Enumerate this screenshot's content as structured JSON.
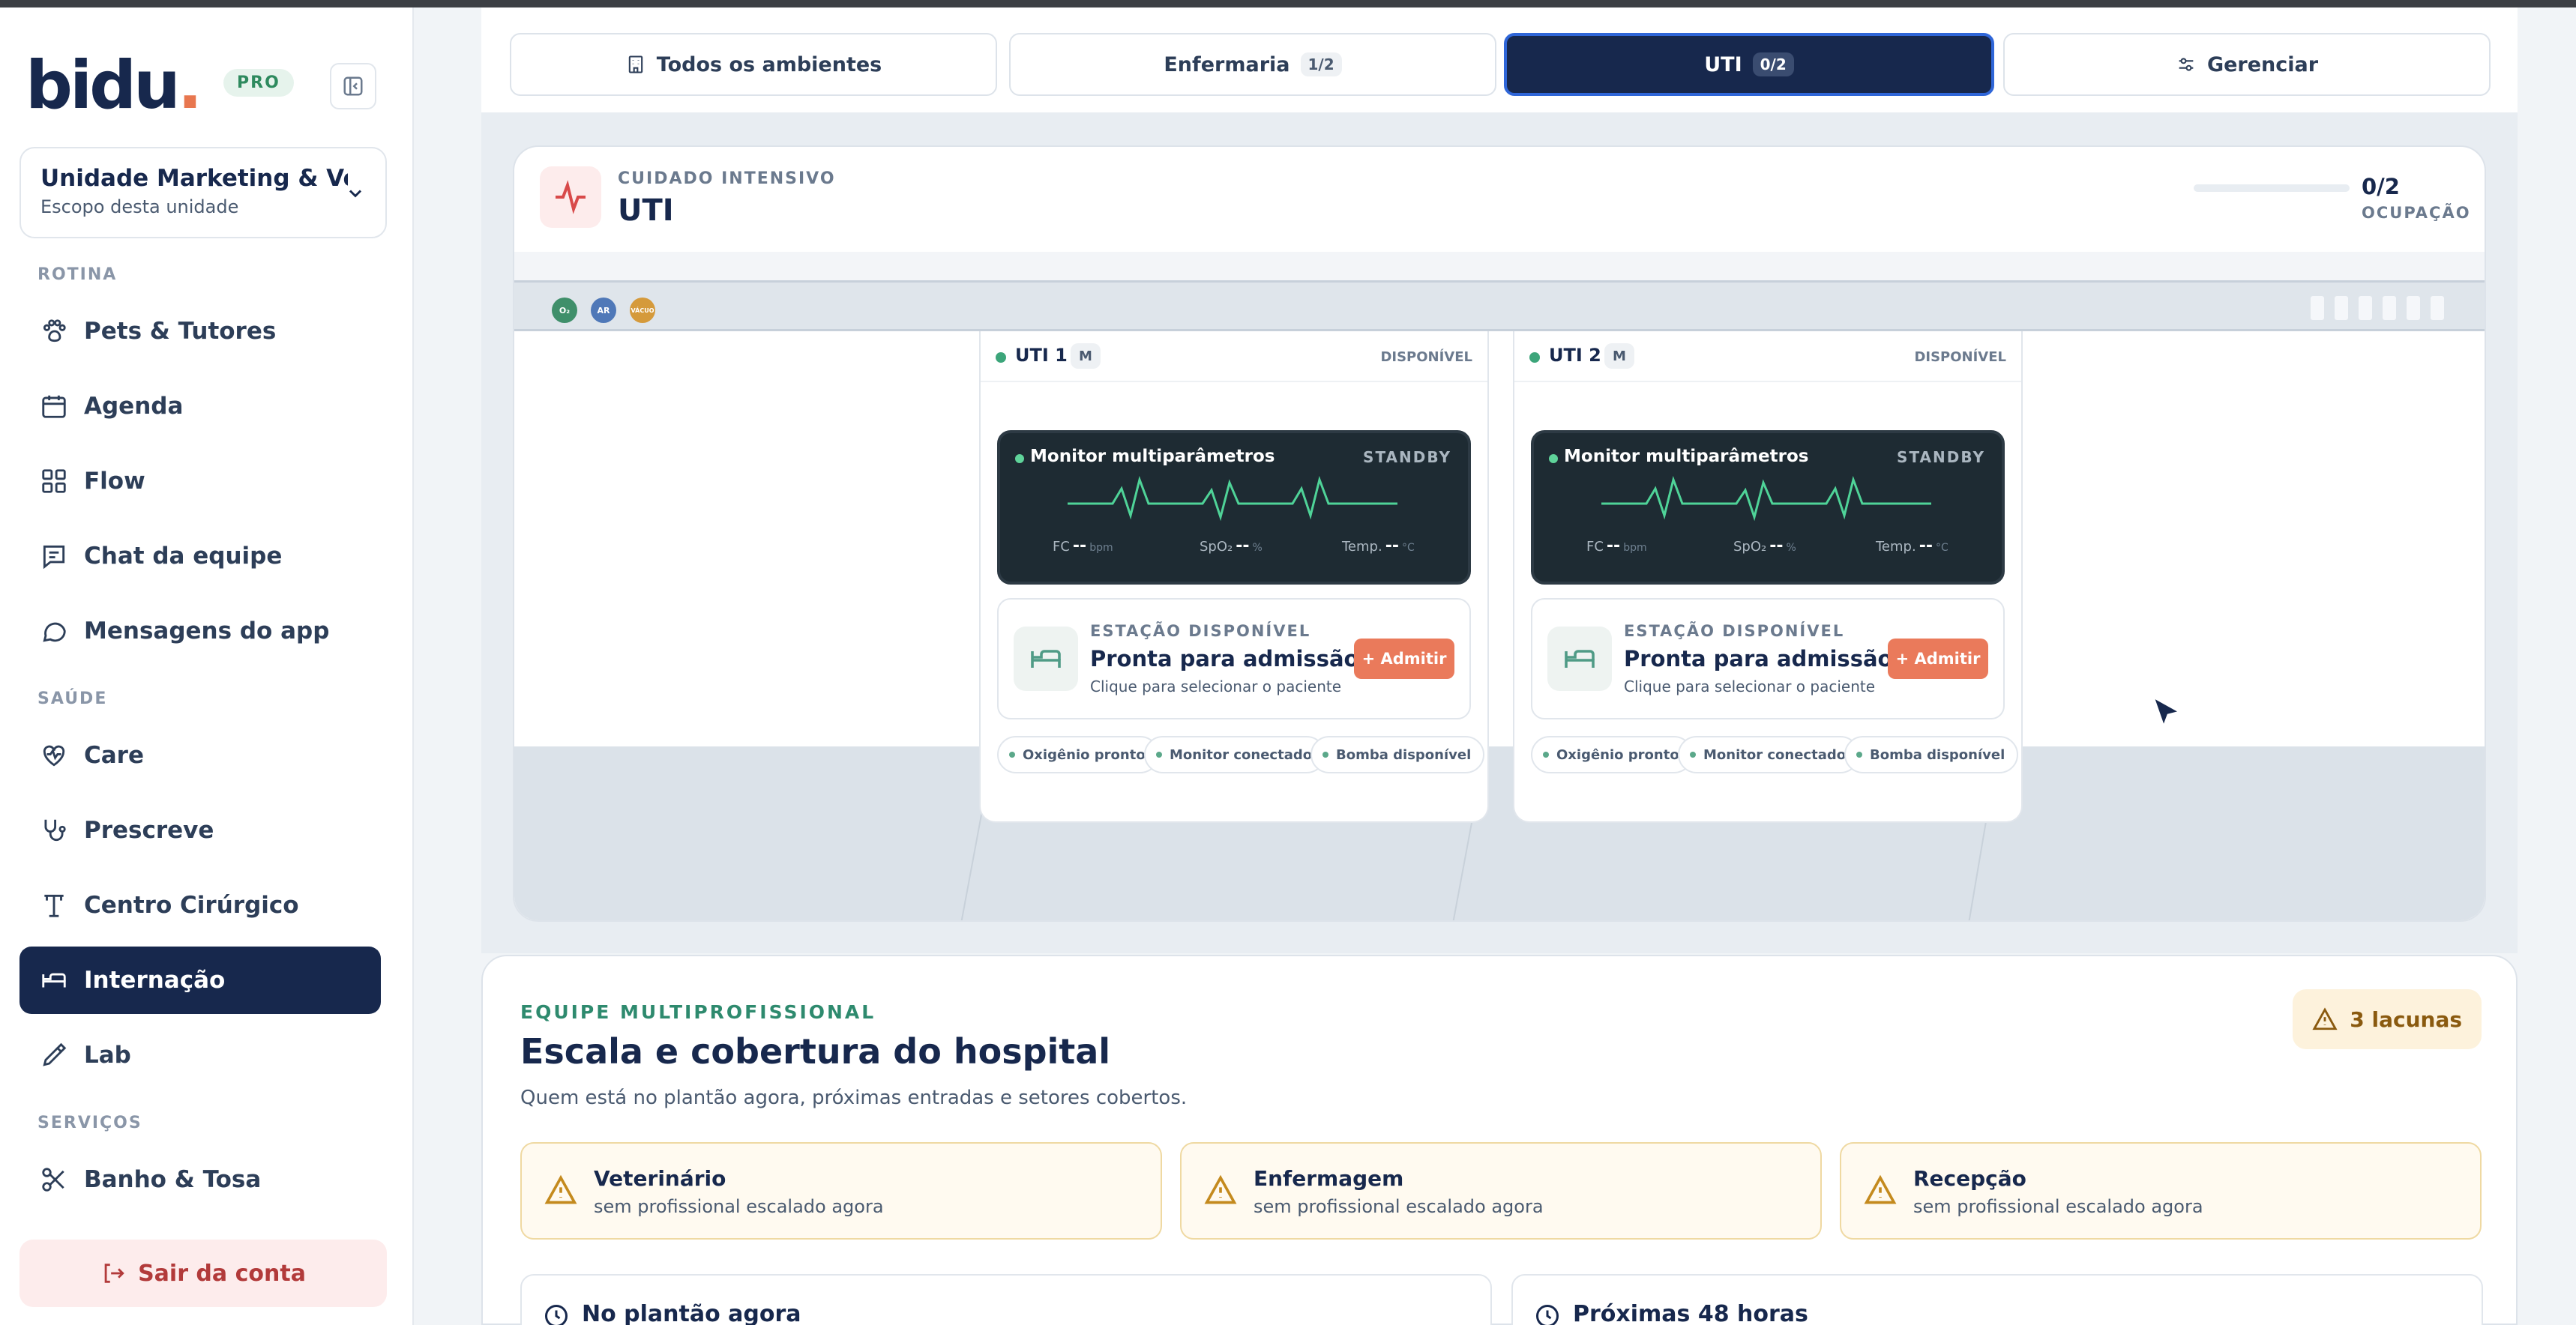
{
  "sidebar": {
    "logo": "bidu",
    "logo_dot": ".",
    "pro": "PRO",
    "unit": {
      "name": "Unidade Marketing & Vend...",
      "sub": "Escopo desta unidade"
    },
    "sections": {
      "rotina": "ROTINA",
      "saude": "SAÚDE",
      "servicos": "SERVIÇOS"
    },
    "items": [
      {
        "label": "Pets & Tutores",
        "icon": "paw-icon"
      },
      {
        "label": "Agenda",
        "icon": "calendar-icon"
      },
      {
        "label": "Flow",
        "icon": "grid-icon"
      },
      {
        "label": "Chat da equipe",
        "icon": "chat-list-icon"
      },
      {
        "label": "Mensagens do app",
        "icon": "message-icon"
      },
      {
        "label": "Care",
        "icon": "heart-pulse-icon"
      },
      {
        "label": "Prescreve",
        "icon": "stethoscope-icon"
      },
      {
        "label": "Centro Cirúrgico",
        "icon": "surgery-lamp-icon"
      },
      {
        "label": "Internação",
        "icon": "bed-icon",
        "active": true
      },
      {
        "label": "Lab",
        "icon": "pipette-icon"
      },
      {
        "label": "Banho & Tosa",
        "icon": "scissors-icon"
      }
    ],
    "logout": "Sair da conta"
  },
  "tabs": [
    {
      "label": "Todos os ambientes",
      "icon": "building-icon"
    },
    {
      "label": "Enfermaria",
      "count": "1/2"
    },
    {
      "label": "UTI",
      "count": "0/2",
      "active": true
    },
    {
      "label": "Gerenciar",
      "icon": "sliders-icon"
    }
  ],
  "room": {
    "kicker": "CUIDADO INTENSIVO",
    "title": "UTI",
    "occupancy": "0/2",
    "occupancy_fraction": 0,
    "occupancy_label": "OCUPAÇÃO",
    "gases": [
      {
        "label": "O₂",
        "color": "#3f8f6a"
      },
      {
        "label": "AR",
        "color": "#4f78b8"
      },
      {
        "label": "VÁCUO",
        "color": "#d59a3b"
      }
    ],
    "bays": [
      {
        "name": "UTI 1",
        "tag": "M",
        "status": "DISPONÍVEL",
        "monitor": {
          "title": "Monitor multiparâmetros",
          "state": "STANDBY",
          "fc_label": "FC",
          "fc_val": "--",
          "fc_unit": "bpm",
          "spo_label": "SpO₂",
          "spo_val": "--",
          "spo_unit": "%",
          "temp_label": "Temp.",
          "temp_val": "--",
          "temp_unit": "°C"
        },
        "station": {
          "kicker": "ESTAÇÃO DISPONÍVEL",
          "title": "Pronta para admissão",
          "sub": "Clique para selecionar o paciente",
          "button": "+ Admitir"
        },
        "chips": [
          "Oxigênio pronto",
          "Monitor conectado",
          "Bomba disponível"
        ]
      },
      {
        "name": "UTI 2",
        "tag": "M",
        "status": "DISPONÍVEL",
        "monitor": {
          "title": "Monitor multiparâmetros",
          "state": "STANDBY",
          "fc_label": "FC",
          "fc_val": "--",
          "fc_unit": "bpm",
          "spo_label": "SpO₂",
          "spo_val": "--",
          "spo_unit": "%",
          "temp_label": "Temp.",
          "temp_val": "--",
          "temp_unit": "°C"
        },
        "station": {
          "kicker": "ESTAÇÃO DISPONÍVEL",
          "title": "Pronta para admissão",
          "sub": "Clique para selecionar o paciente",
          "button": "+ Admitir"
        },
        "chips": [
          "Oxigênio pronto",
          "Monitor conectado",
          "Bomba disponível"
        ]
      }
    ]
  },
  "team": {
    "kicker": "EQUIPE MULTIPROFISSIONAL",
    "title": "Escala e cobertura do hospital",
    "sub": "Quem está no plantão agora, próximas entradas e setores cobertos.",
    "gaps": "3 lacunas",
    "roles": [
      {
        "name": "Veterinário",
        "sub": "sem profissional escalado agora"
      },
      {
        "name": "Enfermagem",
        "sub": "sem profissional escalado agora"
      },
      {
        "name": "Recepção",
        "sub": "sem profissional escalado agora"
      }
    ],
    "shifts": [
      {
        "title": "No plantão agora"
      },
      {
        "title": "Próximas 48 horas"
      }
    ]
  },
  "colors": {
    "navy": "#17284d",
    "accent": "#ea7a5b",
    "warning": "#c48a1e",
    "ok": "#3ca57a"
  }
}
